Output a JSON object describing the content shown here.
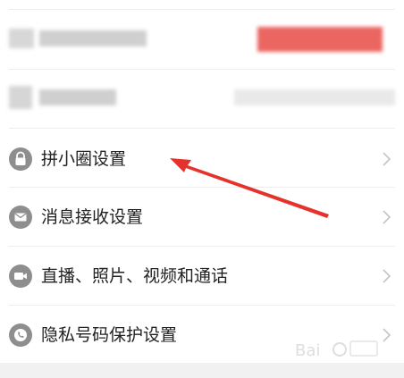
{
  "settings": {
    "items": [
      {
        "label": "拼小圈设置",
        "icon": "lock-icon"
      },
      {
        "label": "消息接收设置",
        "icon": "mail-icon"
      },
      {
        "label": "直播、照片、视频和通话",
        "icon": "video-camera-icon"
      },
      {
        "label": "隐私号码保护设置",
        "icon": "phone-icon"
      }
    ]
  },
  "colors": {
    "accent_red": "#e5322d",
    "icon_gray": "#8e8e8e",
    "divider": "#eeeeee"
  },
  "watermark": {
    "text": "Bai"
  }
}
